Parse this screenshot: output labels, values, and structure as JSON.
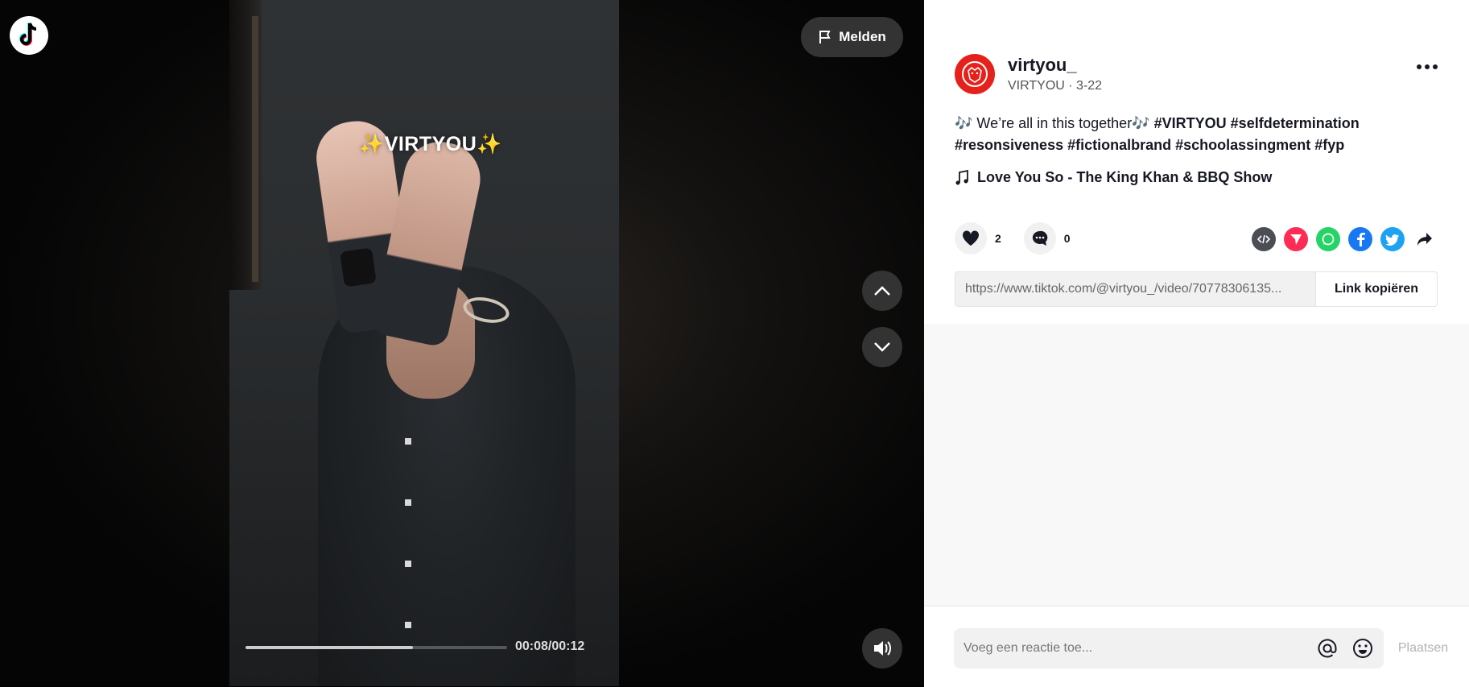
{
  "video": {
    "overlay_left": "✨",
    "overlay_text": "VIRTYOU",
    "overlay_right": "✨",
    "time_label": "00:08/00:12",
    "progress": 0.64
  },
  "controls": {
    "report_label": "Melden"
  },
  "post": {
    "username": "virtyou_",
    "display_name": "VIRTYOU",
    "separator": " · ",
    "date": "3-22",
    "caption_note_1": "🎶",
    "caption_text": " We’re all in this together",
    "caption_note_2": "🎶",
    "hashtags": [
      "#VIRTYOU",
      "#selfdetermination",
      "#resonsiveness",
      "#fictionalbrand",
      "#schoolassingment",
      "#fyp"
    ],
    "music": "Love You So - The King Khan & BBQ Show",
    "likes": "2",
    "comments": "0",
    "link": "https://www.tiktok.com/@virtyou_/video/70778306135...",
    "copy_link_label": "Link kopiëren"
  },
  "share_colors": {
    "embed": "#4b4f55",
    "direct": "#fe2c55",
    "whatsapp": "#25d366",
    "facebook": "#1877f2",
    "twitter": "#1da1f2"
  },
  "comment": {
    "placeholder": "Voeg een reactie toe...",
    "post_label": "Plaatsen"
  }
}
